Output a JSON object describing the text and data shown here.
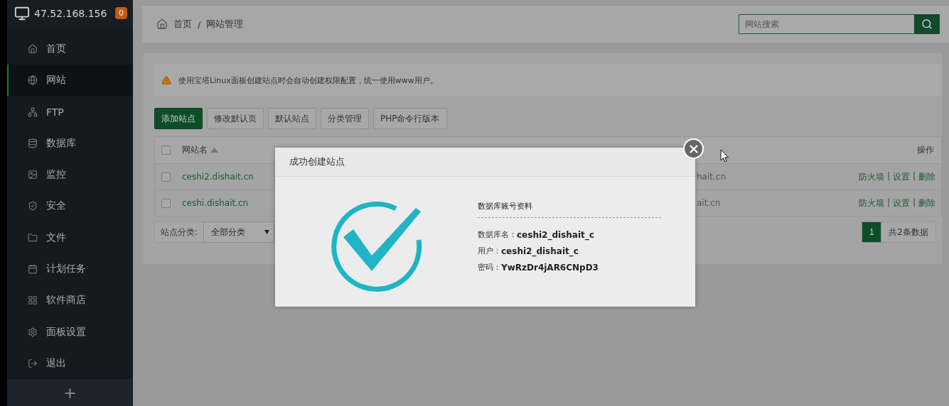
{
  "sidebar": {
    "host": "47.52.168.156",
    "badge": "0",
    "items": [
      {
        "label": "首页",
        "selected": false
      },
      {
        "label": "网站",
        "selected": true
      },
      {
        "label": "FTP",
        "selected": false
      },
      {
        "label": "数据库",
        "selected": false
      },
      {
        "label": "监控",
        "selected": false
      },
      {
        "label": "安全",
        "selected": false
      },
      {
        "label": "文件",
        "selected": false
      },
      {
        "label": "计划任务",
        "selected": false
      },
      {
        "label": "软件商店",
        "selected": false
      },
      {
        "label": "面板设置",
        "selected": false
      },
      {
        "label": "退出",
        "selected": false
      }
    ],
    "add_label": "+"
  },
  "breadcrumb": {
    "items": [
      "首页",
      "网站管理"
    ],
    "separator": "/"
  },
  "search": {
    "placeholder": "网站搜索"
  },
  "notice": "使用宝塔Linux面板创建站点时会自动创建权限配置，统一使用www用户。",
  "toolbar": [
    {
      "label": "添加站点",
      "kind": "primary"
    },
    {
      "label": "修改默认页",
      "kind": "default"
    },
    {
      "label": "默认站点",
      "kind": "default"
    },
    {
      "label": "分类管理",
      "kind": "default"
    },
    {
      "label": "PHP命令行版本",
      "kind": "default"
    }
  ],
  "table": {
    "checked": false,
    "name_header": "网站名",
    "sorted": true,
    "actions_header": "操作",
    "action_separator": "|",
    "rows": [
      {
        "checked": false,
        "name": "ceshi2.dishait.cn",
        "column_3": "hait.cn",
        "actions": [
          "防火墙",
          "设置",
          "删除"
        ]
      },
      {
        "checked": false,
        "name": "ceshi.dishait.cn",
        "column_3": "ait.cn",
        "actions": [
          "防火墙",
          "设置",
          "删除"
        ]
      }
    ]
  },
  "footer": {
    "category_label": "站点分类:",
    "category_value": "全部分类",
    "pages": [
      {
        "label": "1",
        "selected": true
      }
    ],
    "total": "共2条数据"
  },
  "dialog": {
    "title": "成功创建站点",
    "section_title": "数据库账号资料",
    "fields": [
      {
        "label": "数据库名：",
        "value": "ceshi2_dishait_c"
      },
      {
        "label": "用户：",
        "value": "ceshi2_dishait_c"
      },
      {
        "label": "密码：",
        "value": "YwRzDr4jAR6CNpD3"
      }
    ]
  }
}
